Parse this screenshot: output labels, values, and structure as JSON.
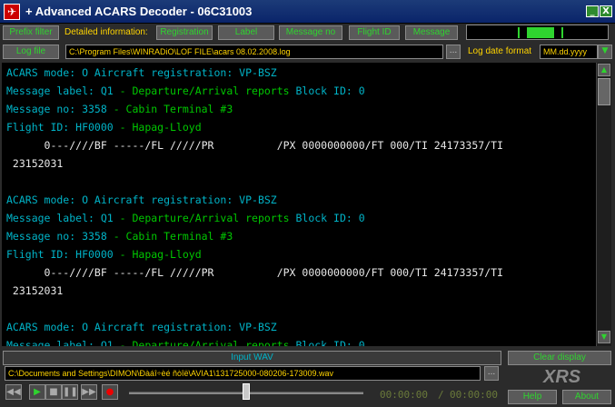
{
  "window": {
    "title": "+ Advanced ACARS Decoder - 06C31003",
    "minimize": "_",
    "close": "X"
  },
  "toolbar": {
    "prefix_filter": "Prefix filter",
    "detailed_label": "Detailed information:",
    "registration": "Registration",
    "label": "Label",
    "message_no": "Message no",
    "flight_id": "Flight ID",
    "message": "Message",
    "log_file": "Log file",
    "log_path": "C:\\Program Files\\WINRADiO\\LOF FILE\\acars 08.02.2008.log",
    "browse": "...",
    "date_format_label": "Log date format",
    "date_format_value": "MM.dd.yyyy"
  },
  "messages": [
    {
      "line1": "ACARS mode: O Aircraft registration: VP-BSZ",
      "line2_a": "Message label: Q1 ",
      "line2_b": "- Departure/Arrival reports",
      "line2_c": " Block ID: 0",
      "line3_a": "Message no: 3358 ",
      "line3_b": "- Cabin Terminal #3",
      "line4_a": "Flight ID: HF0000 ",
      "line4_b": "- Hapag-Lloyd",
      "line5": "      0---////BF -----/FL /////PR          /PX 0000000000/FT 000/TI 24173357/TI",
      "line6": " 23152031"
    },
    {
      "line1": "ACARS mode: O Aircraft registration: VP-BSZ",
      "line2_a": "Message label: Q1 ",
      "line2_b": "- Departure/Arrival reports",
      "line2_c": " Block ID: 0",
      "line3_a": "Message no: 3358 ",
      "line3_b": "- Cabin Terminal #3",
      "line4_a": "Flight ID: HF0000 ",
      "line4_b": "- Hapag-Lloyd",
      "line5": "      0---////BF -----/FL /////PR          /PX 0000000000/FT 000/TI 24173357/TI",
      "line6": " 23152031"
    },
    {
      "line1": "ACARS mode: O Aircraft registration: VP-BSZ",
      "line2_a": "Message label: Q1 ",
      "line2_b": "- Departure/Arrival reports",
      "line2_c": " Block ID: 0"
    }
  ],
  "bottom": {
    "input_wav_label": "Input WAV",
    "wav_path": "C:\\Documents and Settings\\DIMON\\Ðàáî÷èé ñòîë\\AVIA1\\131725000-080206-173009.wav",
    "browse": "...",
    "clear_display": "Clear display",
    "brand": "XRS",
    "help": "Help",
    "about": "About",
    "time_current": "00:00:00",
    "time_sep": "/",
    "time_total": "00:00:00",
    "player_position_fraction": 0.5
  },
  "colors": {
    "accent_green": "#2fd42f",
    "label_yellow": "#ffd400",
    "text_cyan": "#00b4c8",
    "text_green": "#00c800",
    "titlebar_blue": "#0a246a"
  }
}
